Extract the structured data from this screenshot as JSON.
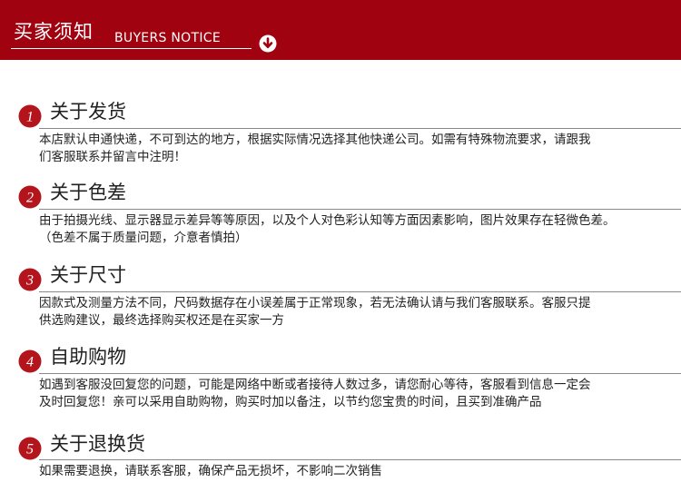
{
  "header": {
    "title": "买家须知",
    "subtitle": "BUYERS NOTICE",
    "icon": "arrow-down-circle-icon",
    "bg_color": "#a1020f"
  },
  "sections": [
    {
      "number": "1",
      "title": "关于发货",
      "lines": [
        "本店默认申通快递，不可到达的地方，根据实际情况选择其他快递公司。如需有特殊物流要求，请跟我",
        "们客服联系并留言中注明！"
      ]
    },
    {
      "number": "2",
      "title": "关于色差",
      "lines": [
        "由于拍摄光线、显示器显示差异等等原因，以及个人对色彩认知等方面因素影响，图片效果存在轻微色差。",
        "（色差不属于质量问题，介意者慎拍）"
      ]
    },
    {
      "number": "3",
      "title": "关于尺寸",
      "lines": [
        "因款式及测量方法不同，尺码数据存在小误差属于正常现象，若无法确认请与我们客服联系。客服只提",
        "供选购建议，最终选择购买权还是在买家一方"
      ]
    },
    {
      "number": "4",
      "title": "自助购物",
      "lines": [
        "如遇到客服没回复您的问题，可能是网络中断或者接待人数过多，请您耐心等待，客服看到信息一定会",
        "及时回复您！亲可以采用自助购物，购买时加以备注，以节约您宝贵的时间，且买到准确产品"
      ]
    },
    {
      "number": "5",
      "title": "关于退换货",
      "lines": [
        "如果需要退换，请联系客服，确保产品无损坏，不影响二次销售"
      ]
    }
  ],
  "badge_color": "#b4141c"
}
